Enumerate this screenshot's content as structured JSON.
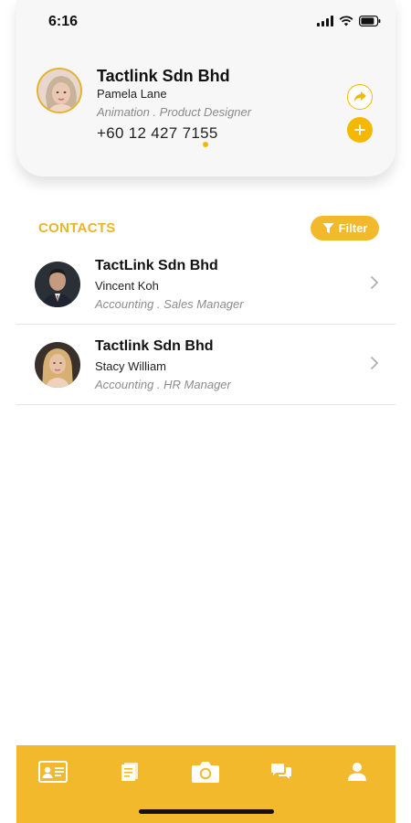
{
  "status_bar": {
    "time": "6:16"
  },
  "profile": {
    "company": "Tactlink Sdn Bhd",
    "name": "Pamela Lane",
    "role": "Animation . Product Designer",
    "phone": "+60 12 427 7155",
    "share_icon": "share-icon",
    "add_icon": "plus-icon"
  },
  "contacts_section": {
    "heading": "CONTACTS",
    "filter_label": "Filter",
    "filter_icon": "filter-icon"
  },
  "contacts": [
    {
      "company": "TactLink Sdn Bhd",
      "name": "Vincent Koh",
      "role": "Accounting . Sales Manager"
    },
    {
      "company": "Tactlink Sdn Bhd",
      "name": "Stacy William",
      "role": "Accounting . HR Manager"
    }
  ],
  "bottom_nav": {
    "items": [
      {
        "icon": "contact-card-icon"
      },
      {
        "icon": "document-icon"
      },
      {
        "icon": "camera-icon"
      },
      {
        "icon": "chat-icon"
      },
      {
        "icon": "user-icon"
      }
    ]
  },
  "colors": {
    "accent": "#f2b92c",
    "heading": "#e9b52a",
    "card_bg": "#f7f7f7",
    "muted_text": "#8a8a8a"
  }
}
